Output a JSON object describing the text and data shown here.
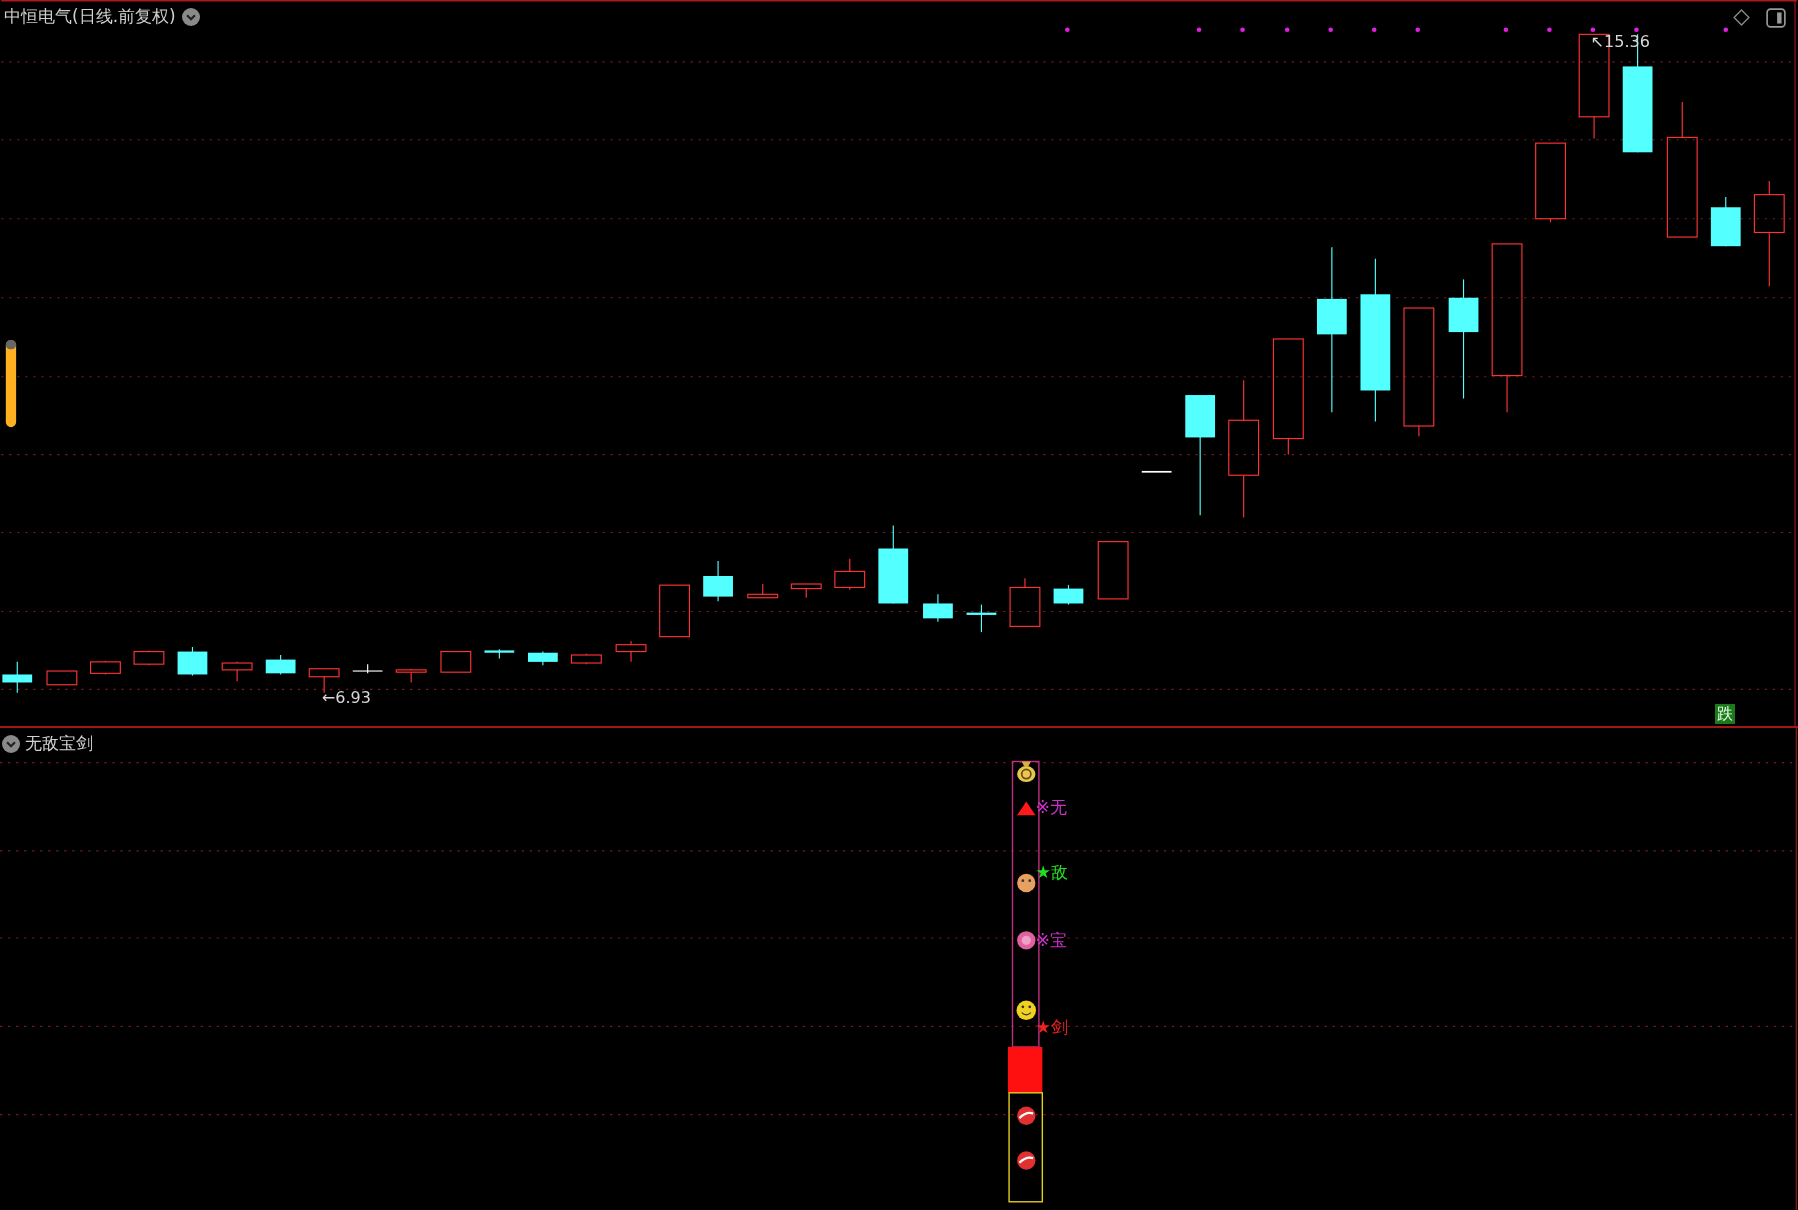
{
  "chart": {
    "title": "中恒电气(日线.前复权)",
    "high_label": "↖15.36",
    "low_label": "←6.93",
    "badge": "跌"
  },
  "indicator": {
    "name": "无敌宝剑",
    "signals": [
      {
        "text": "※无",
        "color": "#cc33cc"
      },
      {
        "text": "★敌",
        "color": "#22dd22"
      },
      {
        "text": "※宝",
        "color": "#cc33cc"
      },
      {
        "text": "★剑",
        "color": "#ee2222"
      }
    ]
  }
}
